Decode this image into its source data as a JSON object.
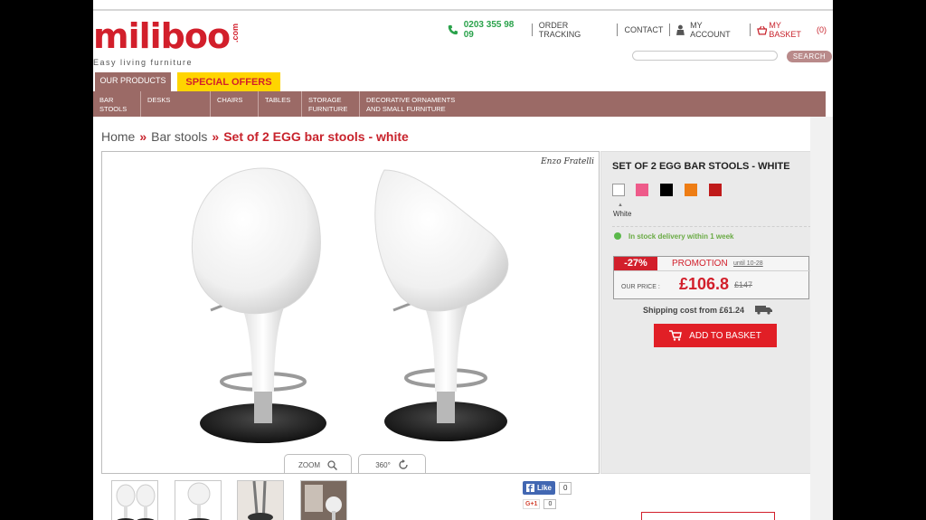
{
  "logo": {
    "word": "miliboo",
    "suffix": ".com",
    "tagline": "Easy living furniture"
  },
  "toplinks": {
    "phone": "0203 355 98 09",
    "order_tracking": "ORDER TRACKING",
    "contact": "CONTACT",
    "account": "MY ACCOUNT",
    "basket": "MY BASKET",
    "basket_count": "(0)"
  },
  "search": {
    "button": "SEARCH",
    "placeholder": ""
  },
  "tabs": {
    "products": "OUR PRODUCTS",
    "offers": "SPECIAL OFFERS"
  },
  "categories": [
    {
      "line1": "BAR",
      "line2": "STOOLS"
    },
    {
      "line1": "DESKS",
      "line2": ""
    },
    {
      "line1": "CHAIRS",
      "line2": ""
    },
    {
      "line1": "TABLES",
      "line2": ""
    },
    {
      "line1": "STORAGE",
      "line2": "FURNITURE"
    },
    {
      "line1": "DECORATIVE ORNAMENTS",
      "line2": "AND SMALL FURNITURE"
    }
  ],
  "breadcrumb": {
    "home": "Home",
    "sep": "»",
    "category": "Bar stools",
    "current": "Set of 2 EGG bar stools - white"
  },
  "gallery": {
    "signature": "Enzo Fratelli",
    "zoom": "ZOOM",
    "rotate": "360°"
  },
  "product": {
    "title": "SET OF 2 EGG BAR STOOLS - WHITE",
    "swatches": [
      "#ffffff",
      "#ee5b8a",
      "#000000",
      "#ee7d14",
      "#c01b1b"
    ],
    "selected_color": "White",
    "stock": "In stock delivery within 1 week",
    "discount": "-27%",
    "promotion": "PROMOTION",
    "until": "until 10-28",
    "our_price_label": "OUR PRICE :",
    "price": "£106.8",
    "old_price": "£147",
    "shipping": "Shipping cost from £61.24",
    "add_to_basket": "ADD TO BASKET"
  },
  "social": {
    "like": "Like",
    "like_count": "0",
    "gplus": "G+1",
    "gplus_count": "0"
  },
  "colors": {
    "brand_red": "#d21f2b",
    "nav_brown": "#9b6a66",
    "offer_yellow": "#ffd500",
    "stock_green": "#5ab84a"
  }
}
